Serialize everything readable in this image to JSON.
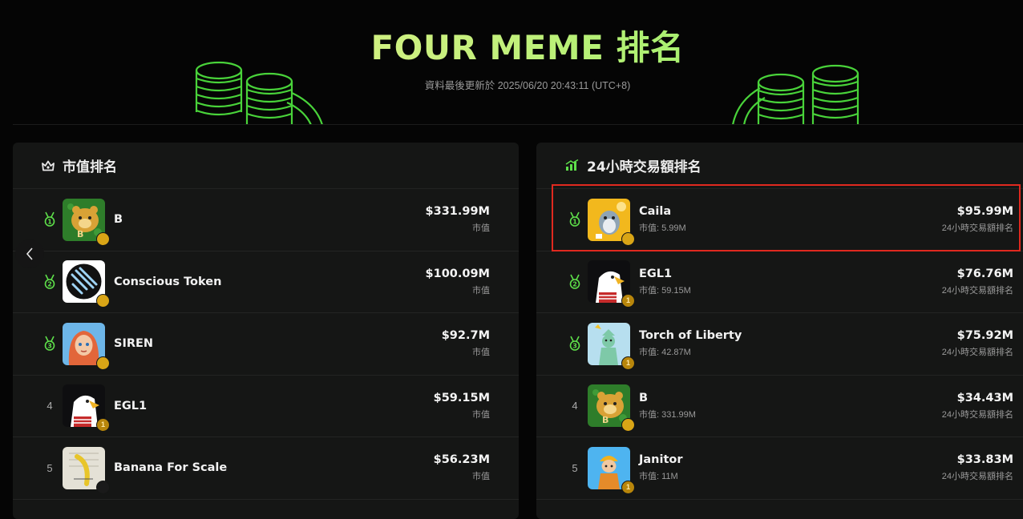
{
  "header": {
    "title": "FOUR MEME 排名",
    "updated": "資料最後更新於 2025/06/20 20:43:11 (UTC+8)"
  },
  "colors": {
    "accent": "#5ee04a",
    "highlight_border": "#e0291f",
    "panel_bg": "#151615"
  },
  "market_cap_panel": {
    "title": "市值排名",
    "icon": "crown-icon",
    "rows": [
      {
        "rank": "1",
        "rank_icon": "medal-1-icon",
        "name": "B",
        "value": "$331.99M",
        "value_label": "市值",
        "badge": "star"
      },
      {
        "rank": "2",
        "rank_icon": "medal-2-icon",
        "name": "Conscious Token",
        "value": "$100.09M",
        "value_label": "市值",
        "badge": "star"
      },
      {
        "rank": "3",
        "rank_icon": "medal-3-icon",
        "name": "SIREN",
        "value": "$92.7M",
        "value_label": "市值",
        "badge": "star"
      },
      {
        "rank": "4",
        "name": "EGL1",
        "value": "$59.15M",
        "value_label": "市值",
        "badge": "one"
      },
      {
        "rank": "5",
        "name": "Banana For Scale",
        "value": "$56.23M",
        "value_label": "市值",
        "badge": "fire"
      }
    ]
  },
  "volume_panel": {
    "title": "24小時交易額排名",
    "icon": "bar-chart-icon",
    "rows": [
      {
        "rank": "1",
        "rank_icon": "medal-1-icon",
        "name": "Caila",
        "sub": "市值: 5.99M",
        "value": "$95.99M",
        "value_label": "24小時交易額排名",
        "badge": "star"
      },
      {
        "rank": "2",
        "rank_icon": "medal-2-icon",
        "name": "EGL1",
        "sub": "市值: 59.15M",
        "value": "$76.76M",
        "value_label": "24小時交易額排名",
        "badge": "one"
      },
      {
        "rank": "3",
        "rank_icon": "medal-3-icon",
        "name": "Torch of Liberty",
        "sub": "市值: 42.87M",
        "value": "$75.92M",
        "value_label": "24小時交易額排名",
        "badge": "one"
      },
      {
        "rank": "4",
        "name": "B",
        "sub": "市值: 331.99M",
        "value": "$34.43M",
        "value_label": "24小時交易額排名",
        "badge": "star"
      },
      {
        "rank": "5",
        "name": "Janitor",
        "sub": "市值: 11M",
        "value": "$33.83M",
        "value_label": "24小時交易額排名",
        "badge": "one"
      }
    ]
  },
  "badges": {
    "one_label": "1"
  }
}
